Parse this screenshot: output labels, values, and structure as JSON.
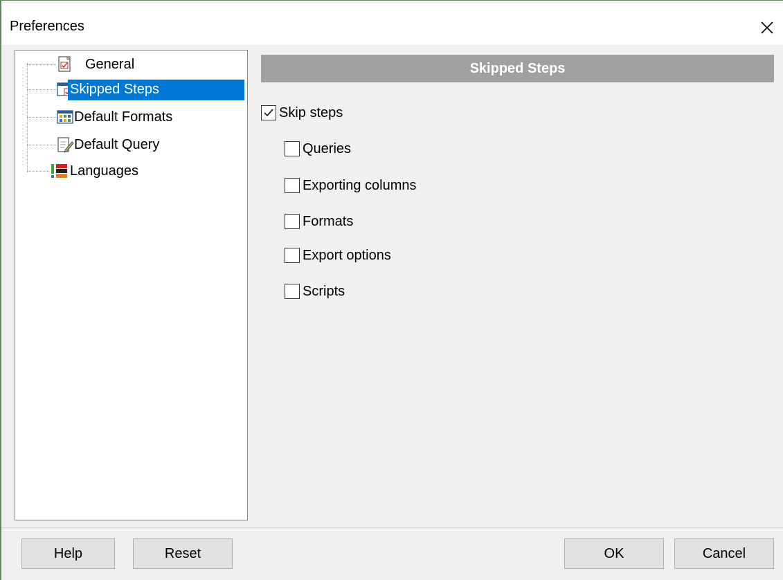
{
  "window": {
    "title": "Preferences",
    "close_label": "×"
  },
  "tree": {
    "items": [
      {
        "label": "General",
        "icon": "general-icon",
        "selected": false
      },
      {
        "label": "Skipped Steps",
        "icon": "skipped-steps-icon",
        "selected": true
      },
      {
        "label": "Default Formats",
        "icon": "default-formats-icon",
        "selected": false
      },
      {
        "label": "Default Query",
        "icon": "default-query-icon",
        "selected": false
      },
      {
        "label": "Languages",
        "icon": "languages-icon",
        "selected": false
      }
    ]
  },
  "panel": {
    "header": "Skipped Steps",
    "skip_steps": {
      "label": "Skip steps",
      "checked": true
    },
    "steps": [
      {
        "label": "Queries",
        "checked": false
      },
      {
        "label": "Exporting columns",
        "checked": false
      },
      {
        "label": "Formats",
        "checked": false
      },
      {
        "label": "Export options",
        "checked": false
      },
      {
        "label": "Scripts",
        "checked": false
      }
    ]
  },
  "footer": {
    "help_label": "Help",
    "reset_label": "Reset",
    "ok_label": "OK",
    "cancel_label": "Cancel"
  },
  "colors": {
    "selection": "#0078d7",
    "header_bg": "#a0a0a0",
    "window_bg": "#f0f0f0"
  }
}
